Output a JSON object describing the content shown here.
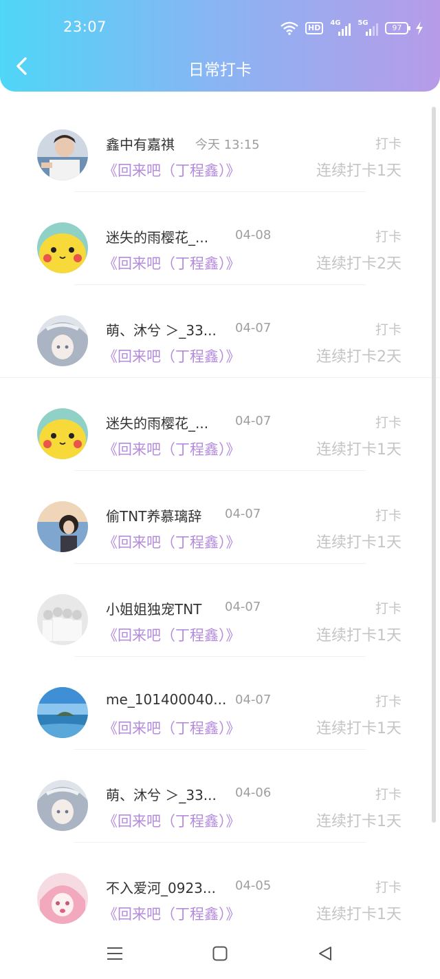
{
  "status_bar": {
    "time": "23:07",
    "icons": [
      "wifi-icon",
      "hd-icon",
      "signal-4g-icon",
      "signal-5g-icon",
      "battery-icon",
      "charging-icon"
    ],
    "hd_label": "HD",
    "net1_label": "4G",
    "net2_label": "5G",
    "battery_level": "97"
  },
  "header": {
    "title": "日常打卡",
    "back_icon": "chevron-left-icon",
    "gradient": [
      "#4fd6f7",
      "#b79be8"
    ]
  },
  "list": {
    "items": [
      {
        "name": "鑫中有嘉祺",
        "date": "今天 13:15",
        "song": "《回来吧（丁程鑫）》",
        "action": "打卡",
        "streak": "连续打卡1天",
        "avatar": "avatar-boy-photo"
      },
      {
        "name": "迷失的雨樱花_...",
        "date": "04-08",
        "song": "《回来吧（丁程鑫）》",
        "action": "打卡",
        "streak": "连续打卡2天",
        "avatar": "avatar-pikachu"
      },
      {
        "name": "萌、沐兮 ＞_33...",
        "date": "04-07",
        "song": "《回来吧（丁程鑫）》",
        "action": "打卡",
        "streak": "连续打卡2天",
        "avatar": "avatar-anime-girl"
      },
      {
        "name": "迷失的雨樱花_...",
        "date": "04-07",
        "song": "《回来吧（丁程鑫）》",
        "action": "打卡",
        "streak": "连续打卡1天",
        "avatar": "avatar-pikachu"
      },
      {
        "name": "偷TNT养慕璃辞",
        "date": "04-07",
        "song": "《回来吧（丁程鑫）》",
        "action": "打卡",
        "streak": "连续打卡1天",
        "avatar": "avatar-girl-sky"
      },
      {
        "name": "小姐姐独宠TNT",
        "date": "04-07",
        "song": "《回来吧（丁程鑫）》",
        "action": "打卡",
        "streak": "连续打卡1天",
        "avatar": "avatar-group-photo"
      },
      {
        "name": "me_101400040...",
        "date": "04-07",
        "song": "《回来吧（丁程鑫）》",
        "action": "打卡",
        "streak": "连续打卡1天",
        "avatar": "avatar-sea"
      },
      {
        "name": "萌、沐兮 ＞_33...",
        "date": "04-06",
        "song": "《回来吧（丁程鑫）》",
        "action": "打卡",
        "streak": "连续打卡1天",
        "avatar": "avatar-anime-girl"
      },
      {
        "name": "不入爱河_0923...",
        "date": "04-05",
        "song": "《回来吧（丁程鑫）》",
        "action": "打卡",
        "streak": "连续打卡1天",
        "avatar": "avatar-anime-pink"
      }
    ]
  },
  "nav_bar": {
    "icons": [
      "menu-icon",
      "home-square-icon",
      "back-triangle-icon"
    ]
  },
  "colors": {
    "song": "#b48bdc",
    "name": "#333333",
    "muted": "#c4c4c4",
    "date": "#9e9e9e"
  }
}
